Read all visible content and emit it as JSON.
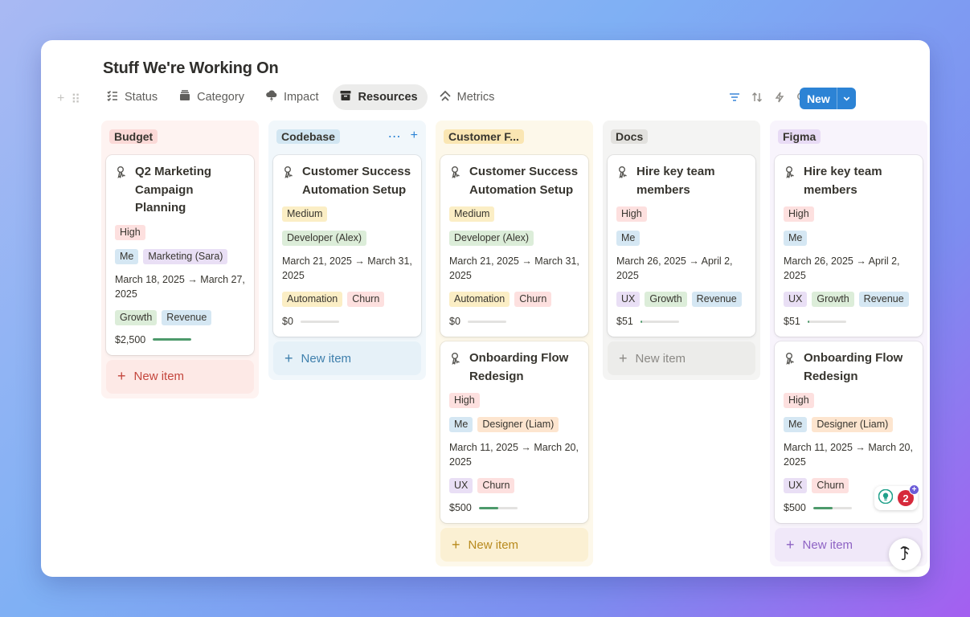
{
  "page": {
    "title": "Stuff We're Working On"
  },
  "views": [
    {
      "label": "Status",
      "icon": "checklist-icon"
    },
    {
      "label": "Category",
      "icon": "archive-stack-icon"
    },
    {
      "label": "Impact",
      "icon": "cloud-lightning-icon"
    },
    {
      "label": "Resources",
      "icon": "archive-box-icon",
      "active": true
    },
    {
      "label": "Metrics",
      "icon": "chevrons-up-icon"
    }
  ],
  "toolbar": {
    "new_label": "New"
  },
  "colors": {
    "accent": "#2c83d5",
    "progress": "#4d9a6b"
  },
  "columns": [
    {
      "name": "Budget",
      "cards": [
        {
          "title": "Q2 Marketing Campaign Planning",
          "priority": "High",
          "people": [
            "Me",
            "Marketing (Sara)"
          ],
          "date": "March 18, 2025 → March 27, 2025",
          "tags": [
            "Growth",
            "Revenue"
          ],
          "amount": "$2,500",
          "progress": 1.0
        }
      ],
      "new_item": "New item"
    },
    {
      "name": "Codebase",
      "cards": [
        {
          "title": "Customer Success Automation Setup",
          "priority": "Medium",
          "people": [
            "Developer (Alex)"
          ],
          "date": "March 21, 2025 → March 31, 2025",
          "tags": [
            "Automation",
            "Churn"
          ],
          "amount": "$0",
          "progress": 0
        }
      ],
      "new_item": "New item"
    },
    {
      "name": "Customer F...",
      "cards": [
        {
          "title": "Customer Success Automation Setup",
          "priority": "Medium",
          "people": [
            "Developer (Alex)"
          ],
          "date": "March 21, 2025 → March 31, 2025",
          "tags": [
            "Automation",
            "Churn"
          ],
          "amount": "$0",
          "progress": 0
        },
        {
          "title": "Onboarding Flow Redesign",
          "priority": "High",
          "people": [
            "Me",
            "Designer (Liam)"
          ],
          "date": "March 11, 2025 → March 20, 2025",
          "tags": [
            "UX",
            "Churn"
          ],
          "amount": "$500",
          "progress": 0.5
        }
      ],
      "new_item": "New item"
    },
    {
      "name": "Docs",
      "cards": [
        {
          "title": "Hire key team members",
          "priority": "High",
          "people": [
            "Me"
          ],
          "date": "March 26, 2025 → April 2, 2025",
          "tags": [
            "UX",
            "Growth",
            "Revenue"
          ],
          "amount": "$51",
          "progress": 0.05
        }
      ],
      "new_item": "New item"
    },
    {
      "name": "Figma",
      "cards": [
        {
          "title": "Hire key team members",
          "priority": "High",
          "people": [
            "Me"
          ],
          "date": "March 26, 2025 → April 2, 2025",
          "tags": [
            "UX",
            "Growth",
            "Revenue"
          ],
          "amount": "$51",
          "progress": 0.05
        },
        {
          "title": "Onboarding Flow Redesign",
          "priority": "High",
          "people": [
            "Me",
            "Designer (Liam)"
          ],
          "date": "March 11, 2025 → March 20, 2025",
          "tags": [
            "UX",
            "Churn"
          ],
          "amount": "$500",
          "progress": 0.5
        }
      ],
      "new_item": "New item"
    }
  ],
  "notifications": {
    "count": "2",
    "plus": "+"
  }
}
